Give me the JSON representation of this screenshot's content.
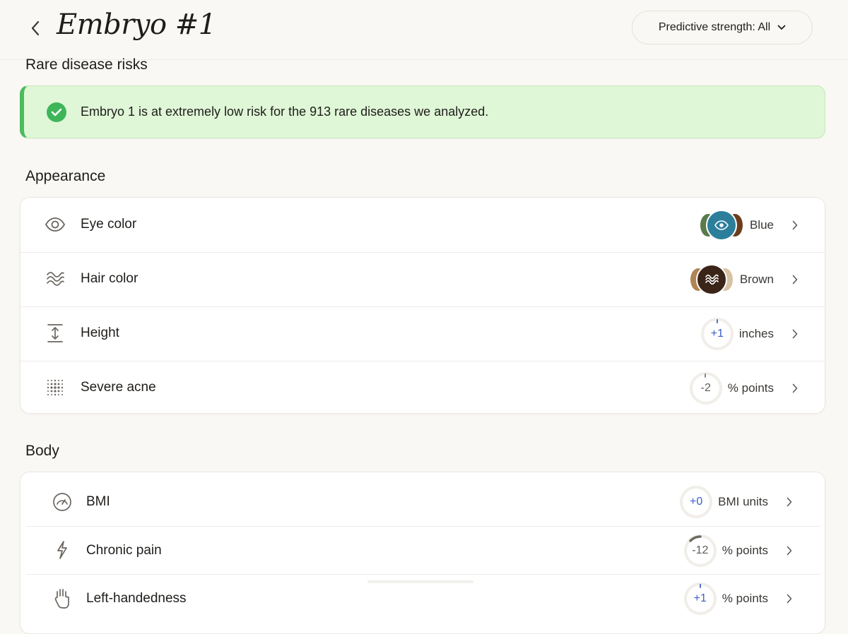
{
  "header": {
    "title": "Embryo #1",
    "back_icon": "chevron-left-icon",
    "strength_label": "Predictive strength: All"
  },
  "sections": {
    "rare": "Rare disease risks",
    "appearance": "Appearance",
    "body": "Body"
  },
  "banner": {
    "text": "Embryo 1 is at extremely low risk for the 913 rare diseases we analyzed.",
    "color": "#dff7d7",
    "accent": "#4dbb5c"
  },
  "appearance": [
    {
      "icon": "eye-icon",
      "label": "Eye color",
      "value": "Blue",
      "swatch": {
        "main": "#2c7f9b",
        "left": "#5a7a4a",
        "right": "#6b3d1e"
      }
    },
    {
      "icon": "waves-icon",
      "label": "Hair color",
      "value": "Brown",
      "swatch": {
        "main": "#3b2418",
        "left": "#b08453",
        "right": "#d8c2a4"
      }
    },
    {
      "icon": "height-arrows-icon",
      "label": "Height",
      "delta": "+1",
      "unit": "inches"
    },
    {
      "icon": "dots-grid-icon",
      "label": "Severe acne",
      "delta": "-2",
      "unit": "% points"
    }
  ],
  "body": [
    {
      "icon": "gauge-icon",
      "label": "BMI",
      "delta": "+0",
      "unit": "BMI units"
    },
    {
      "icon": "lightning-icon",
      "label": "Chronic pain",
      "delta": "-12",
      "unit": "% points"
    },
    {
      "icon": "hand-icon",
      "label": "Left-handedness",
      "delta": "+1",
      "unit": "% points"
    }
  ],
  "colors": {
    "positive": "#3a5fc8",
    "neutral": "#5f5b55"
  }
}
